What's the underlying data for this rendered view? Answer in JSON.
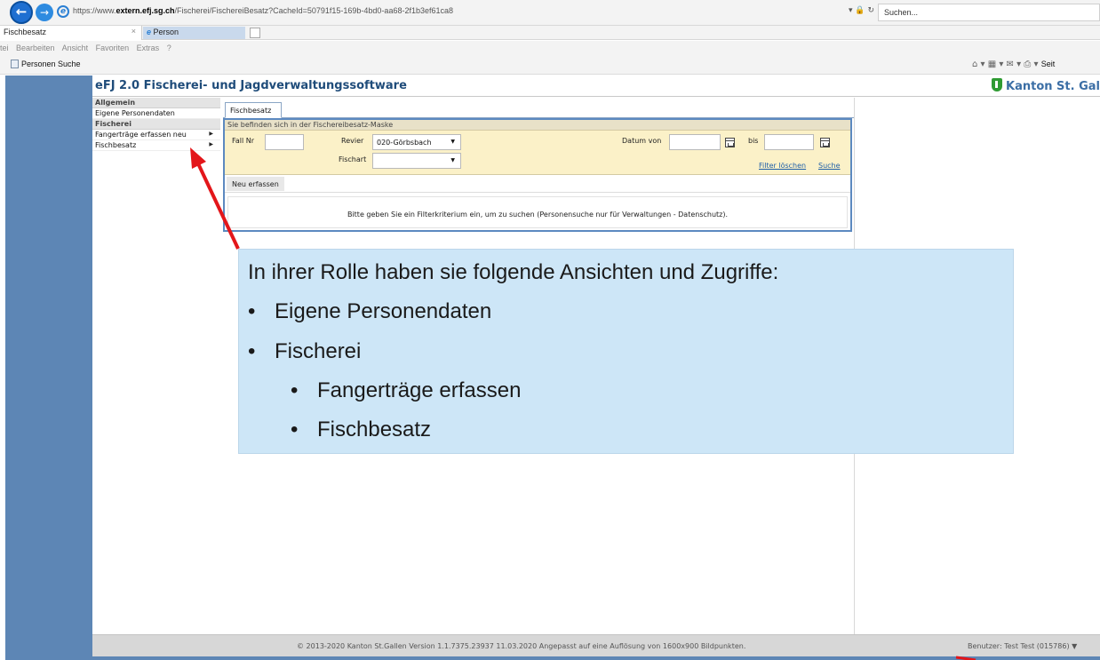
{
  "browser": {
    "url_prefix": "https://www.",
    "url_domain": "extern.efj.sg.ch",
    "url_path": "/Fischerei/FischereiBesatz?CacheId=50791f15-169b-4bd0-aa68-2f1b3ef61ca8",
    "addr_tools": "▾ 🔒 ↻",
    "search_placeholder": "Suchen...",
    "tabs": [
      {
        "label": "Fischbesatz",
        "close": "×"
      },
      {
        "label": "Person"
      }
    ],
    "menu": [
      "tei",
      "Bearbeiten",
      "Ansicht",
      "Favoriten",
      "Extras",
      "?"
    ],
    "favorites": [
      {
        "label": "Personen Suche"
      }
    ],
    "cmd_icons": "⌂ ▾  ▦ ▾  ✉ ▾  ⎙ ▾",
    "cmd_seite": "Seit"
  },
  "app": {
    "title": "eFJ 2.0 Fischerei- und Jagdverwaltungssoftware",
    "brand": "Kanton St. Gal"
  },
  "sidebar": {
    "sections": [
      {
        "title": "Allgemein",
        "items": [
          {
            "label": "Eigene Personendaten",
            "arrow": ""
          }
        ]
      },
      {
        "title": "Fischerei",
        "items": [
          {
            "label": "Fangerträge erfassen neu",
            "arrow": "▶"
          },
          {
            "label": "Fischbesatz",
            "arrow": "▶"
          }
        ]
      }
    ]
  },
  "main": {
    "tab": "Fischbesatz",
    "breadcrumb": "Sie befinden sich in der Fischereibesatz-Maske",
    "filter": {
      "fall_nr_label": "Fall Nr",
      "revier_label": "Revier",
      "revier_value": "020-Görbsbach",
      "fischart_label": "Fischart",
      "fischart_value": "",
      "datum_von_label": "Datum von",
      "bis_label": "bis",
      "filter_loeschen": "Filter löschen",
      "suche": "Suche",
      "dropdown_glyph": "▼"
    },
    "new_button": "Neu erfassen",
    "message": "Bitte geben Sie ein Filterkriterium ein, um zu suchen (Personensuche nur für Verwaltungen - Datenschutz)."
  },
  "footer": {
    "copyright": "© 2013-2020 Kanton St.Gallen Version 1.1.7375.23937 11.03.2020    Angepasst auf eine Auflösung von 1600x900 Bildpunkten.",
    "user": "Benutzer:  Test Test (015786) ▼"
  },
  "callout": {
    "title": "In ihrer Rolle haben sie folgende Ansichten und Zugriffe:",
    "bullet": "•",
    "items": [
      {
        "text": "Eigene Personendaten"
      },
      {
        "text": "Fischerei"
      },
      {
        "text": "Fangerträge erfassen"
      },
      {
        "text": "Fischbesatz"
      }
    ]
  },
  "colors": {
    "sidebar_strip": "#5d86b5",
    "title_text": "#1f4c7a",
    "filter_bg": "#fbf1c8",
    "callout_bg": "#cde6f7",
    "arrow_red": "#e3161a",
    "brand_shield": "#2f9b33"
  },
  "icons": {
    "back": "back-arrow-icon",
    "forward": "forward-arrow-icon",
    "browser": "ie-logo-icon",
    "calendar": "calendar-icon",
    "shield": "kanton-shield-icon"
  }
}
